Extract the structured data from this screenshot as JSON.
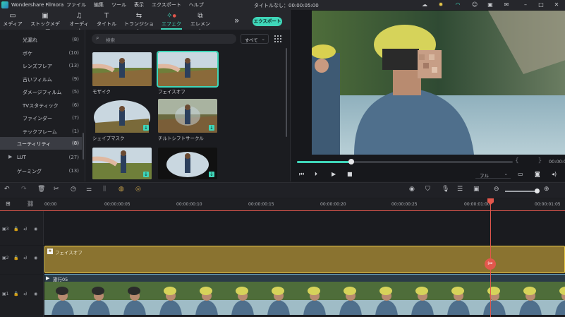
{
  "app_title": "Wondershare Filmora",
  "menus": [
    "ファイル",
    "編集",
    "ツール",
    "表示",
    "エクスポート",
    "ヘルプ"
  ],
  "document_title": "タイトルなし：00:00:05:00",
  "toolbar": {
    "tabs": [
      {
        "label": "メディア",
        "icon": "folder-icon"
      },
      {
        "label": "ストックメディア",
        "icon": "stock-media-icon"
      },
      {
        "label": "オーディオ",
        "icon": "music-note-icon"
      },
      {
        "label": "タイトル",
        "icon": "title-t-icon"
      },
      {
        "label": "トランジション",
        "icon": "transition-icon"
      },
      {
        "label": "エフェクト",
        "icon": "effect-wand-icon"
      },
      {
        "label": "エレメント",
        "icon": "element-icon"
      }
    ],
    "active_tab": "エフェクト",
    "export_label": "エクスポート"
  },
  "sidebar": {
    "items": [
      {
        "label": "光漏れ",
        "count": "(8)"
      },
      {
        "label": "ボケ",
        "count": "(10)"
      },
      {
        "label": "レンズフレア",
        "count": "(13)"
      },
      {
        "label": "古いフィルム",
        "count": "(9)"
      },
      {
        "label": "ダメージフィルム",
        "count": "(5)"
      },
      {
        "label": "TVスタティック",
        "count": "(6)"
      },
      {
        "label": "ファインダー",
        "count": "(7)"
      },
      {
        "label": "テックフレーム",
        "count": "(1)"
      },
      {
        "label": "ユーティリティ",
        "count": "(8)"
      },
      {
        "label": "LUT",
        "count": "(27)"
      },
      {
        "label": "ゲーミング",
        "count": "(13)"
      }
    ],
    "selected": "ユーティリティ"
  },
  "search": {
    "placeholder": "検索"
  },
  "filter": {
    "value": "すべて"
  },
  "effects": [
    {
      "label": "モザイク"
    },
    {
      "label": "フェイスオフ"
    },
    {
      "label": "シェイプマスク"
    },
    {
      "label": "チルトシフトサークル"
    },
    {
      "label": ""
    },
    {
      "label": ""
    }
  ],
  "selected_effect": "フェイスオフ",
  "preview": {
    "timecode": "00:00:01",
    "quality": "フル",
    "progress": 0.25
  },
  "ruler": {
    "labels": [
      "00:00",
      "00:00:00:05",
      "00:00:00:10",
      "00:00:00:15",
      "00:00:00:20",
      "00:00:00:25",
      "00:00:01:00",
      "00:00:01:05"
    ]
  },
  "tracks": {
    "effect_clip": "フェイスオフ",
    "video_clip": "旅行05",
    "track_numbers": [
      "3",
      "2",
      "1"
    ]
  },
  "colors": {
    "accent": "#3fd6b9",
    "playhead": "#e2574c",
    "effect_clip": "#8a7330"
  }
}
